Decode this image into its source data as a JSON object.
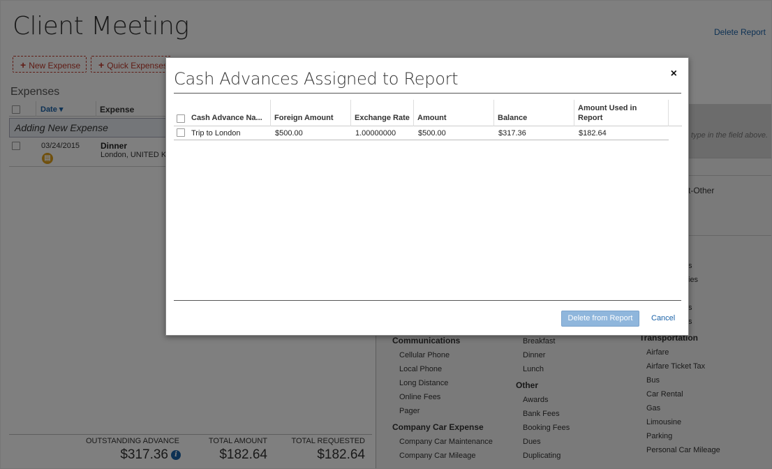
{
  "page": {
    "title": "Client Meeting",
    "delete_report": "Delete Report",
    "new_expense": "New Expense",
    "quick_expenses": "Quick Expenses",
    "expenses_heading": "Expenses",
    "date_col": "Date",
    "expense_col": "Expense",
    "adding_new_expense": "Adding New Expense",
    "expense_row": {
      "date": "03/24/2015",
      "title": "Dinner",
      "location": "London, UNITED KIN"
    },
    "totals": {
      "outstanding_label": "OUTSTANDING ADVANCE",
      "outstanding_value": "$317.36",
      "amount_label": "TOTAL AMOUNT",
      "amount_value": "$182.64",
      "requested_label": "TOTAL REQUESTED",
      "requested_value": "$182.64"
    }
  },
  "right_panel": {
    "hint": "type in the field above.",
    "frag_other": "t-Other",
    "frag_s1": "s",
    "frag_ies": "ies",
    "frag_s2": "s",
    "frag_s3": "s",
    "col1": {
      "communications": "Communications",
      "comm_items": [
        "Cellular Phone",
        "Local Phone",
        "Long Distance",
        "Online Fees",
        "Pager"
      ],
      "company_car": "Company Car Expense",
      "car_items": [
        "Company Car Maintenance",
        "Company Car Mileage"
      ]
    },
    "col2": {
      "meal_items": [
        "Breakfast",
        "Dinner",
        "Lunch"
      ],
      "other": "Other",
      "other_items": [
        "Awards",
        "Bank Fees",
        "Booking Fees",
        "Dues",
        "Duplicating"
      ]
    },
    "col3": {
      "transportation": "Transportation",
      "trans_items": [
        "Airfare",
        "Airfare Ticket Tax",
        "Bus",
        "Car Rental",
        "Gas",
        "Limousine",
        "Parking",
        "Personal Car Mileage"
      ]
    }
  },
  "modal": {
    "title": "Cash Advances Assigned to Report",
    "close": "×",
    "columns": {
      "name": "Cash Advance Na...",
      "foreign_amount": "Foreign Amount",
      "exchange_rate": "Exchange Rate",
      "amount": "Amount",
      "balance": "Balance",
      "amount_used": "Amount Used in Report"
    },
    "rows": [
      {
        "name": "Trip to London",
        "foreign_amount": "$500.00",
        "exchange_rate": "1.00000000",
        "amount": "$500.00",
        "balance": "$317.36",
        "amount_used": "$182.64"
      }
    ],
    "delete_button": "Delete from Report",
    "cancel_button": "Cancel"
  }
}
